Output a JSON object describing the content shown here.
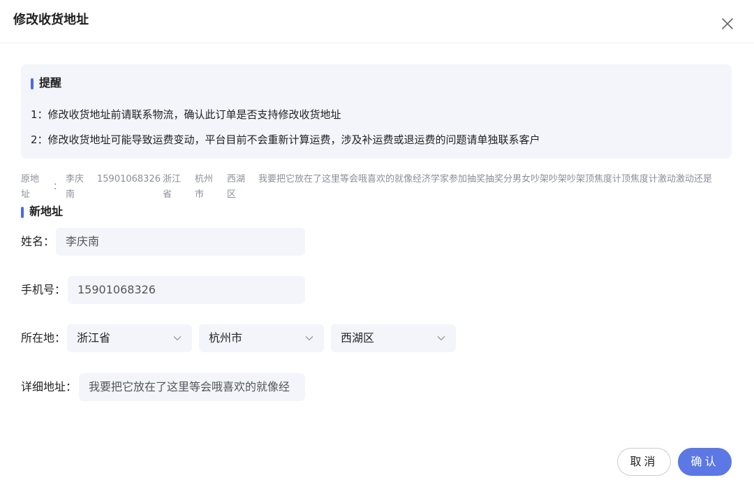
{
  "dialog": {
    "title": "修改收货地址"
  },
  "reminder": {
    "title": "提醒",
    "lines": [
      "1：修改收货地址前请联系物流，确认此订单是否支持修改收货地址",
      "2：修改收货地址可能导致运费变动，平台目前不会重新计算运费，涉及补运费或退运费的问题请单独联系客户"
    ]
  },
  "original": {
    "label": "原地址",
    "colon": "：",
    "name": "李庆南",
    "phone": "15901068326",
    "province": "浙江省",
    "city": "杭州市",
    "district": "西湖区",
    "detail": "我要把它放在了这里等会哦喜欢的就像经济学家参加抽奖抽奖分男女吵架吵架吵架顶焦度计顶焦度计激动激动还是"
  },
  "new_address": {
    "title": "新地址",
    "name_label": "姓名：",
    "name_value": "李庆南",
    "phone_label": "手机号：",
    "phone_value": "15901068326",
    "region_label": "所在地：",
    "province": "浙江省",
    "city": "杭州市",
    "district": "西湖区",
    "detail_label": "详细地址：",
    "detail_value": "我要把它放在了这里等会哦喜欢的就像经"
  },
  "footer": {
    "cancel_label": "取消",
    "ok_label": "确认"
  },
  "colors": {
    "accent": "#5b78e4",
    "section_bar": "#4a6be6",
    "panel_bg": "#f3f5fb",
    "muted_text": "#8a8f99"
  },
  "icons": {
    "close": "close-icon",
    "dropdown": "chevron-down-icon"
  }
}
